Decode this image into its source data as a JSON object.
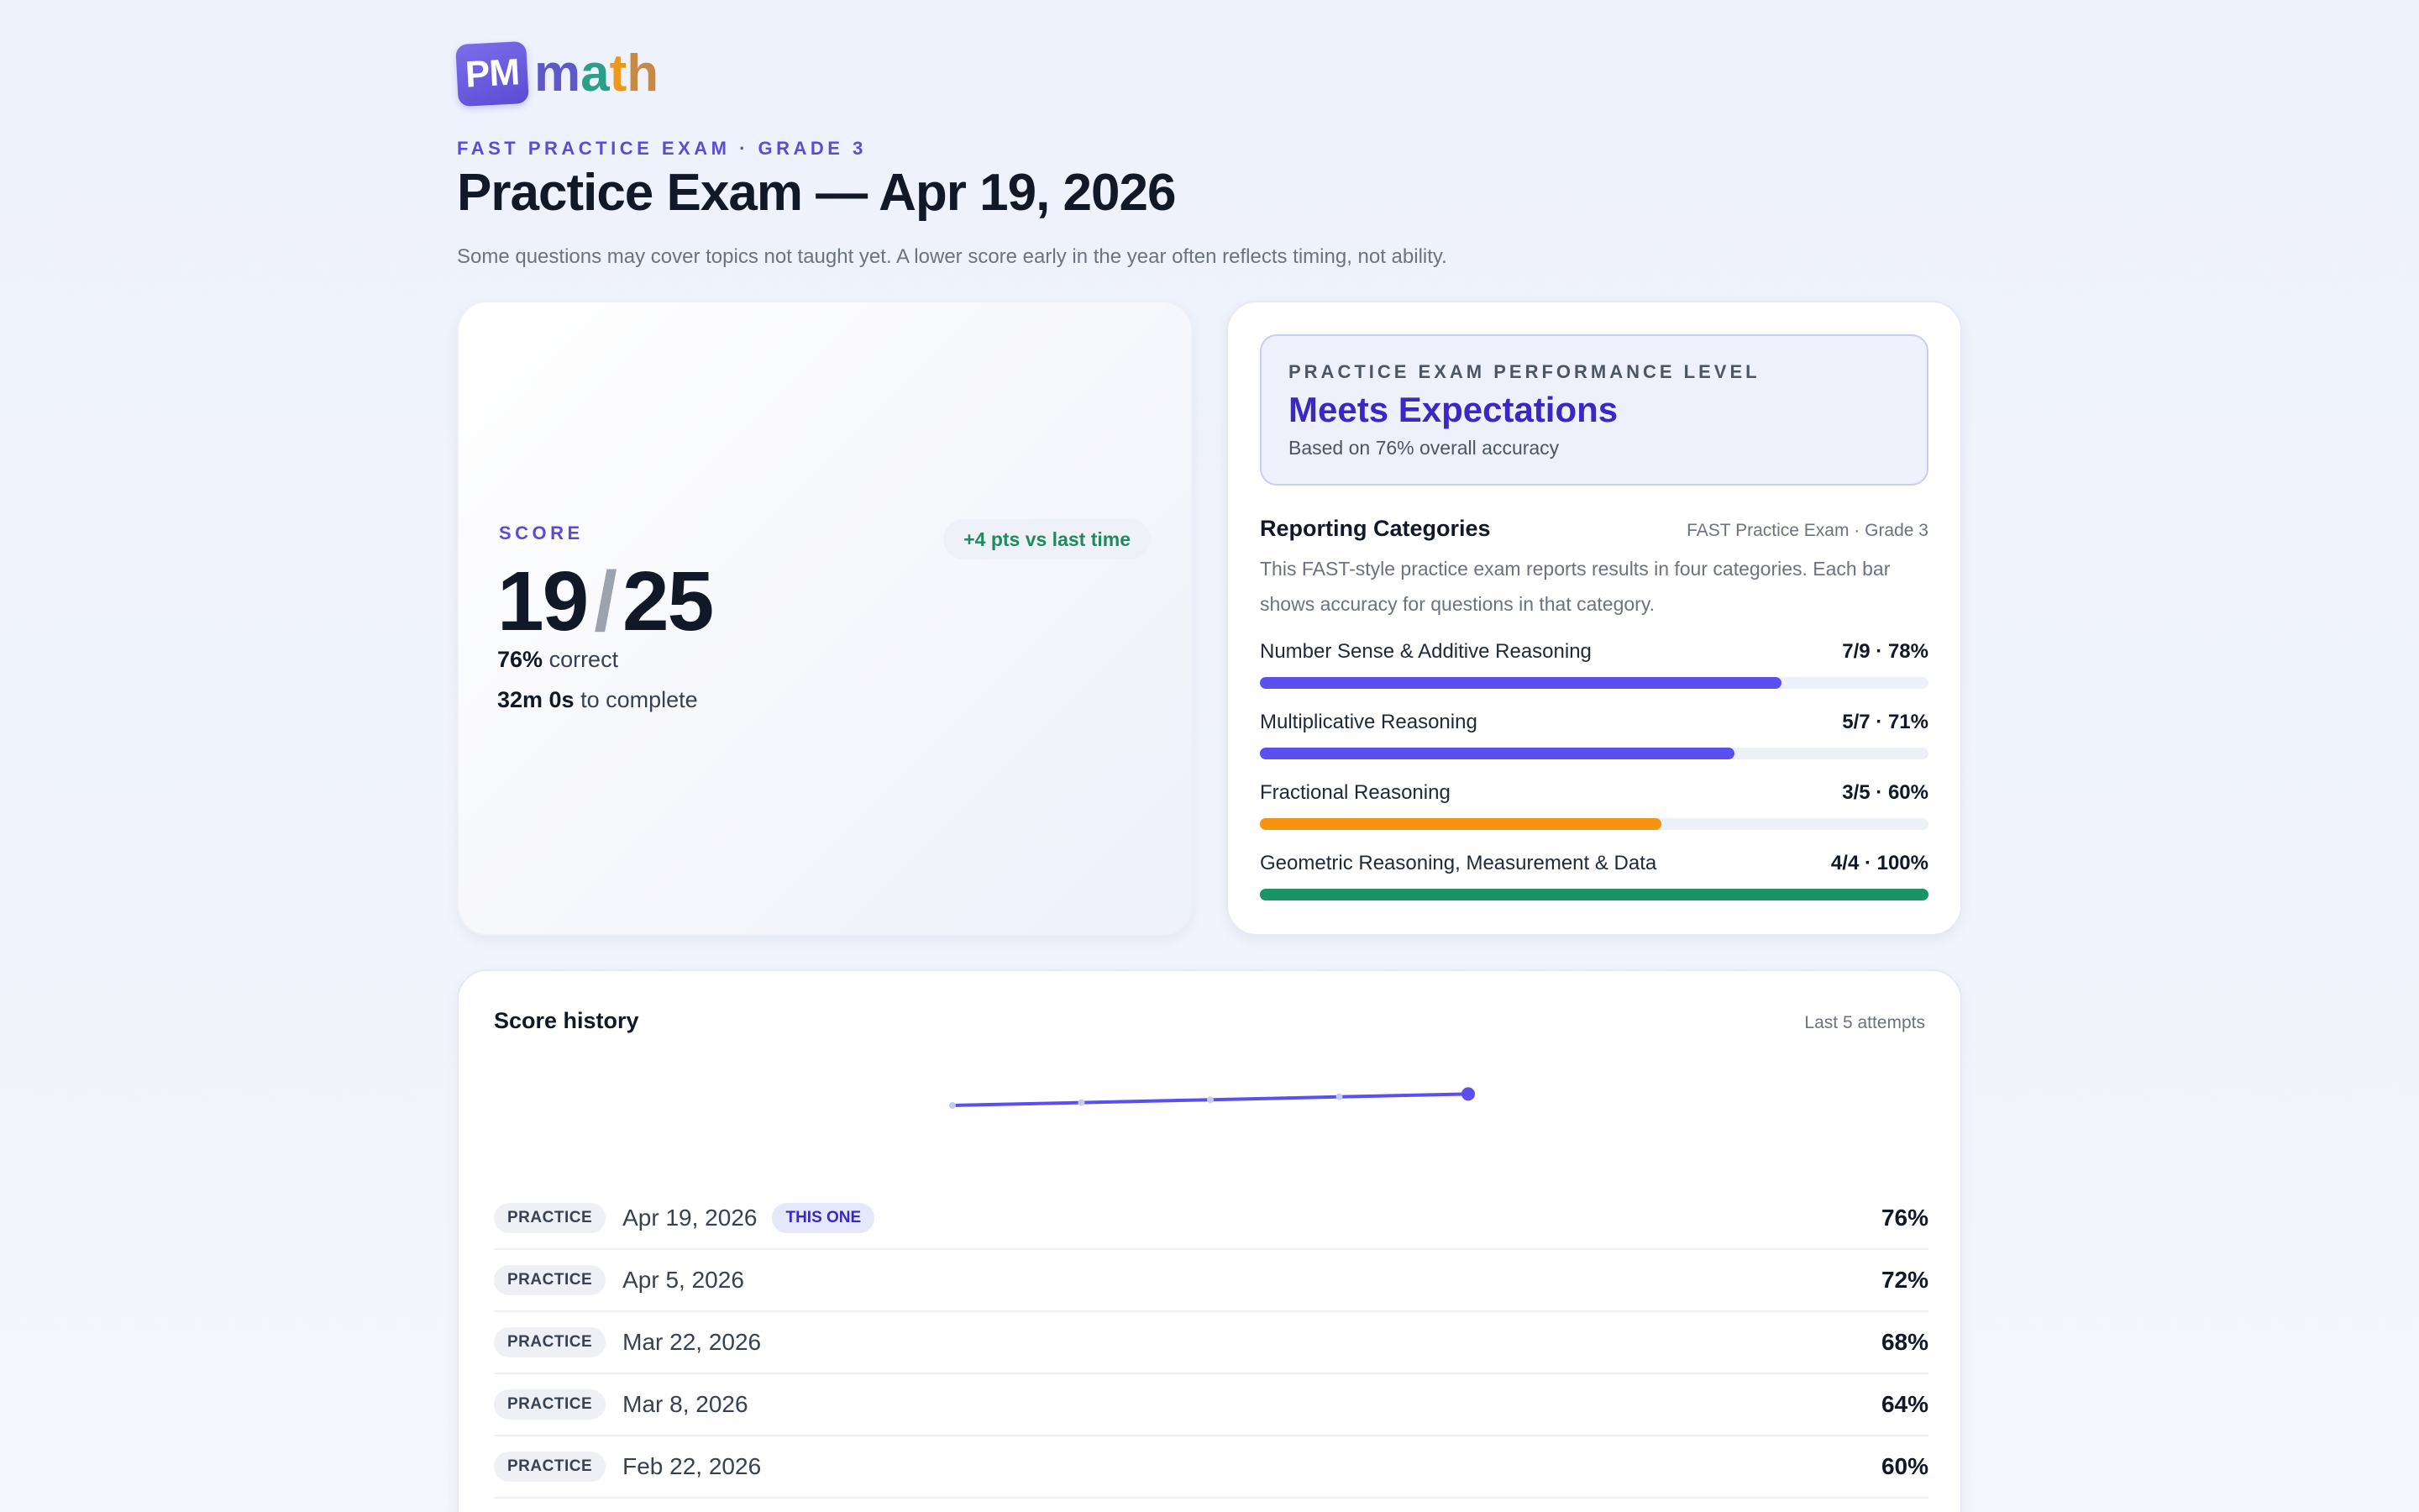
{
  "logo": {
    "badge": "PM",
    "word": [
      "m",
      "a",
      "t",
      "h"
    ]
  },
  "header": {
    "eyebrow": "FAST PRACTICE EXAM · GRADE 3",
    "title": "Practice Exam — Apr 19, 2026",
    "subtitle": "Some questions may cover topics not taught yet. A lower score early in the year often reflects timing, not ability."
  },
  "score": {
    "label": "SCORE",
    "delta": "+4 pts vs last time",
    "correct": "19",
    "slash": "/",
    "total": "25",
    "percent": "76%",
    "percent_suffix": "correct",
    "time": "32m 0s",
    "time_suffix": "to complete"
  },
  "performance": {
    "eyebrow": "PRACTICE EXAM PERFORMANCE LEVEL",
    "level": "Meets Expectations",
    "basis": "Based on 76% overall accuracy"
  },
  "reporting": {
    "title": "Reporting Categories",
    "meta": "FAST Practice Exam · Grade 3",
    "description": "This FAST-style practice exam reports results in four categories. Each bar shows accuracy for questions in that category.",
    "categories": [
      {
        "name": "Number Sense & Additive Reasoning",
        "value": "7/9 · 78%",
        "accuracy": 0.78,
        "color": "#5b4ff0"
      },
      {
        "name": "Multiplicative Reasoning",
        "value": "5/7 · 71%",
        "accuracy": 0.71,
        "color": "#5b4ff0"
      },
      {
        "name": "Fractional Reasoning",
        "value": "3/5 · 60%",
        "accuracy": 0.6,
        "color": "#f5930f"
      },
      {
        "name": "Geometric Reasoning, Measurement & Data",
        "value": "4/4 · 100%",
        "accuracy": 1.0,
        "color": "#1a9466"
      }
    ]
  },
  "history": {
    "title": "Score history",
    "meta": "Last 5 attempts",
    "trend": [
      60,
      64,
      68,
      72,
      76
    ],
    "line_color": "#5b4ff0",
    "rows": [
      {
        "type": "PRACTICE",
        "date": "Apr 19, 2026",
        "tag": "THIS ONE",
        "score": "76%"
      },
      {
        "type": "PRACTICE",
        "date": "Apr 5, 2026",
        "tag": "",
        "score": "72%"
      },
      {
        "type": "PRACTICE",
        "date": "Mar 22, 2026",
        "tag": "",
        "score": "68%"
      },
      {
        "type": "PRACTICE",
        "date": "Mar 8, 2026",
        "tag": "",
        "score": "64%"
      },
      {
        "type": "PRACTICE",
        "date": "Feb 22, 2026",
        "tag": "",
        "score": "60%"
      }
    ]
  }
}
